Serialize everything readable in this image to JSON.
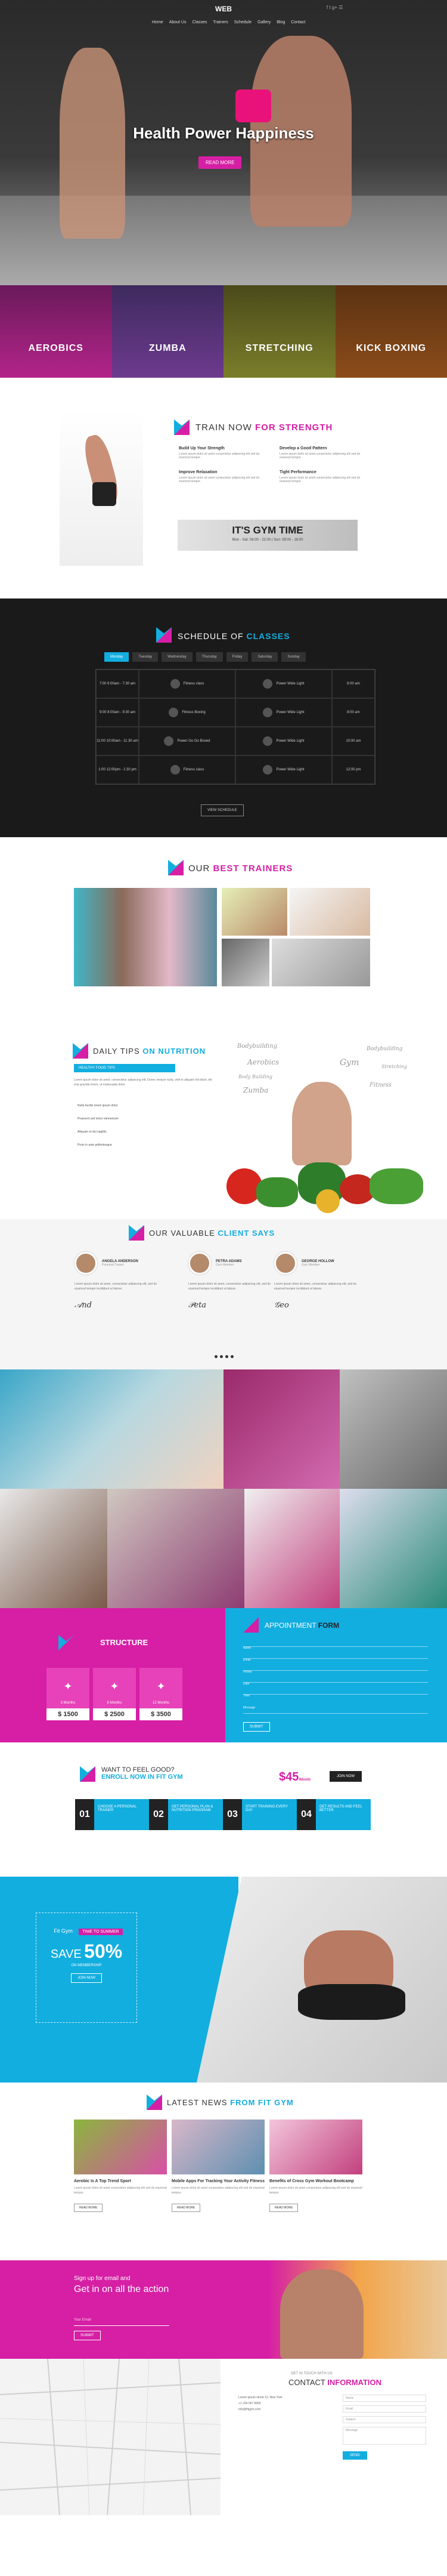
{
  "header": {
    "logo_text": "WEB",
    "nav": [
      "Home",
      "About Us",
      "Classes",
      "Trainers",
      "Schedule",
      "Gallery",
      "Blog",
      "Contact"
    ]
  },
  "hero": {
    "title": "Health Power Happiness",
    "button": "READ MORE"
  },
  "class_strip": [
    {
      "label": "AEROBICS",
      "color": "#b3248a"
    },
    {
      "label": "ZUMBA",
      "color": "#6d3a8e"
    },
    {
      "label": "STRETCHING",
      "color": "#7a7e2a"
    },
    {
      "label": "KICK BOXING",
      "color": "#8c4c1a"
    }
  ],
  "strength": {
    "title_plain": "TRAIN NOW ",
    "title_accent": "FOR STRENGTH",
    "features": [
      {
        "title": "Build Up Your Strength",
        "text": "Lorem ipsum dolor sit amet consectetur adipiscing elit sed do eiusmod tempor."
      },
      {
        "title": "Develop a Good Pattern",
        "text": "Lorem ipsum dolor sit amet consectetur adipiscing elit sed do eiusmod tempor."
      },
      {
        "title": "Improve Relaxation",
        "text": "Lorem ipsum dolor sit amet consectetur adipiscing elit sed do eiusmod tempor."
      },
      {
        "title": "Tight Performance",
        "text": "Lorem ipsum dolor sit amet consectetur adipiscing elit sed do eiusmod tempor."
      }
    ],
    "banner_title": "IT'S GYM TIME",
    "banner_sub": "Mon - Sat: 06:00 - 22:00 | Sun: 08:00 - 18:00"
  },
  "schedule": {
    "title_plain": "SCHEDULE OF ",
    "title_accent": "CLASSES",
    "tabs": [
      "Monday",
      "Tuesday",
      "Wednesday",
      "Thursday",
      "Friday",
      "Saturday",
      "Sunday"
    ],
    "rows": [
      {
        "time": "7:00\n6:00am - 7:30 am",
        "a": "Fitness class",
        "b": "Power Wide Light",
        "d": "6:00 am"
      },
      {
        "time": "9:00\n8:00am - 9:30 am",
        "a": "Fitness Boxing",
        "b": "Power Wide Light",
        "d": "8:00 am"
      },
      {
        "time": "11:00\n10:00am - 11:30 am",
        "a": "Power Go Go Boxed",
        "b": "Power Wide Light",
        "d": "10:00 am"
      },
      {
        "time": "1:00\n12:00pm - 1:30 pm",
        "a": "Fitness class",
        "b": "Power Wide Light",
        "d": "12:00 pm"
      }
    ],
    "button": "VIEW SCHEDULE"
  },
  "trainers": {
    "title_plain": "OUR ",
    "title_accent": "BEST TRAINERS"
  },
  "nutrition": {
    "title_plain": "DAILY TIPS ",
    "title_accent": "ON NUTRITION",
    "active_item": "HEALTHY FOOD TIPS",
    "paragraph": "Lorem ipsum dolor sit amet, consectetur adipiscing elit. Donec tempor nulla, velit et aliquam tincidunt, elit erat gravida lorem, ut malesuada dolor.",
    "list": [
      "Nulla facilisi lorem ipsum dolor",
      "Praesent sed tortor elementum",
      "Aliquam et dui sagittis",
      "Proin in ante pellentesque"
    ],
    "tags": [
      "Bodybuilding",
      "Aerobics",
      "Gym",
      "Bodybuilding",
      "Stretching",
      "Body Building",
      "Fitness",
      "Zumba"
    ]
  },
  "testimonials": {
    "title_plain": "OUR VALUABLE ",
    "title_accent": "CLIENT SAYS",
    "items": [
      {
        "name": "ANGELA ANDERSON",
        "role": "Personal Trainer",
        "text": "Lorem ipsum dolor sit amet, consectetur adipiscing elit, sed do eiusmod tempor incididunt ut labore."
      },
      {
        "name": "PETRA ADAMS",
        "role": "Gym Member",
        "text": "Lorem ipsum dolor sit amet, consectetur adipiscing elit, sed do eiusmod tempor incididunt ut labore."
      },
      {
        "name": "GEORGE HOLLOW",
        "role": "Gym Member",
        "text": "Lorem ipsum dolor sit amet, consectetur adipiscing elit, sed do eiusmod tempor incididunt ut labore."
      }
    ]
  },
  "structure": {
    "title": "STRUCTURE",
    "plans": [
      {
        "label": "3 Months",
        "price": "$ 1500"
      },
      {
        "label": "6 Months",
        "price": "$ 2500"
      },
      {
        "label": "12 Months",
        "price": "$ 3500"
      }
    ]
  },
  "appointment": {
    "title_plain": "APPOINTMENT ",
    "title_accent": "FORM",
    "fields": [
      "Name",
      "Email",
      "Phone",
      "Date",
      "Time",
      "Message"
    ],
    "button": "SUBMIT"
  },
  "enroll": {
    "line1": "WANT TO FEEL GOOD?",
    "line2": "ENROLL NOW IN FIT GYM",
    "price": "$45",
    "price_suffix": "/Month",
    "button": "JOIN NOW",
    "steps": [
      {
        "num": "01",
        "text": "Choose a Personal Trainer",
        "color": "#12aee0"
      },
      {
        "num": "02",
        "text": "Get Personal Plan & Nutrition Program",
        "color": "#12aee0"
      },
      {
        "num": "03",
        "text": "Start Training Every Day",
        "color": "#12aee0"
      },
      {
        "num": "04",
        "text": "Get Results and Feel Better",
        "color": "#12aee0"
      }
    ]
  },
  "sale": {
    "logo": "Fit Gym",
    "kicker": "TIME TO SUMMER",
    "big": "SAVE",
    "percent": "50%",
    "small": "ON MEMBERSHIP",
    "button": "JOIN NOW"
  },
  "news": {
    "title_plain": "LATEST NEWS ",
    "title_accent": "FROM FIT GYM",
    "items": [
      {
        "title": "Aerobic Is A Top Trend Sport",
        "text": "Lorem ipsum dolor sit amet consectetur adipiscing elit sed do eiusmod tempor.",
        "button": "READ MORE"
      },
      {
        "title": "Mobile Apps For Tracking Your Activity Fitness",
        "text": "Lorem ipsum dolor sit amet consectetur adipiscing elit sed do eiusmod tempor.",
        "button": "READ MORE"
      },
      {
        "title": "Benefits of Cross Gym Workout Bootcamp",
        "text": "Lorem ipsum dolor sit amet consectetur adipiscing elit sed do eiusmod tempor.",
        "button": "READ MORE"
      }
    ]
  },
  "newsletter": {
    "line1": "Sign up for email and",
    "line2": "Get in on all the action",
    "placeholder": "Your Email",
    "button": "SUBMIT"
  },
  "contact": {
    "kicker": "GET IN TOUCH WITH US",
    "title_plain": "CONTACT ",
    "title_accent": "INFORMATION",
    "address": "Lorem ipsum street 12, New York",
    "phone": "+1 234 567 8900",
    "email": "info@fitgym.com",
    "fields": [
      "Name",
      "Email",
      "Subject",
      "Message"
    ],
    "button": "SEND"
  },
  "colors": {
    "pink": "#d61fa5",
    "blue": "#12aee0",
    "dark": "#1a1a1a"
  }
}
